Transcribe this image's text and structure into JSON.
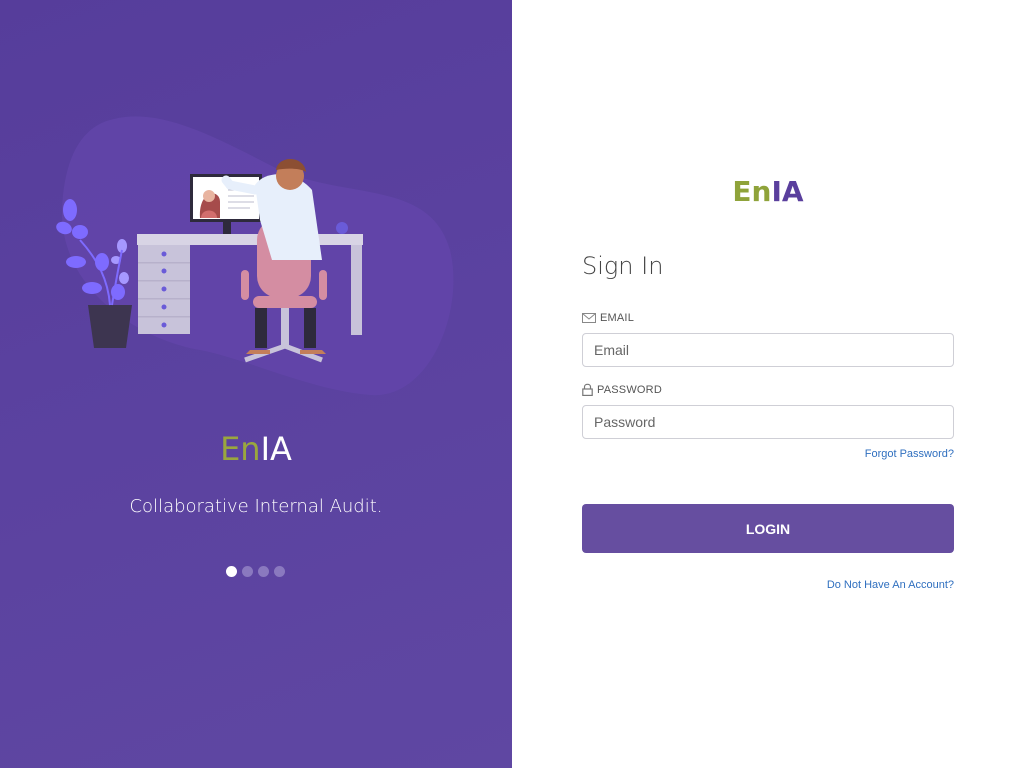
{
  "left": {
    "logo": {
      "part1": "En",
      "part2": "IA"
    },
    "tagline": "Collaborative Internal Audit.",
    "carousel": {
      "count": 4,
      "active_index": 0
    }
  },
  "right": {
    "logo": {
      "part1": "En",
      "part2": "IA"
    },
    "title": "Sign In",
    "email": {
      "label": "EMAIL",
      "placeholder": "Email",
      "value": "",
      "icon": "envelope-icon"
    },
    "password": {
      "label": "PASSWORD",
      "placeholder": "Password",
      "value": "",
      "icon": "lock-icon"
    },
    "forgot_link": "Forgot Password?",
    "login_button": "LOGIN",
    "signup_link": "Do Not Have An Account?"
  },
  "colors": {
    "brand_purple": "#664ea0",
    "brand_green": "#8fa33a",
    "link_blue": "#2f6fbf"
  }
}
